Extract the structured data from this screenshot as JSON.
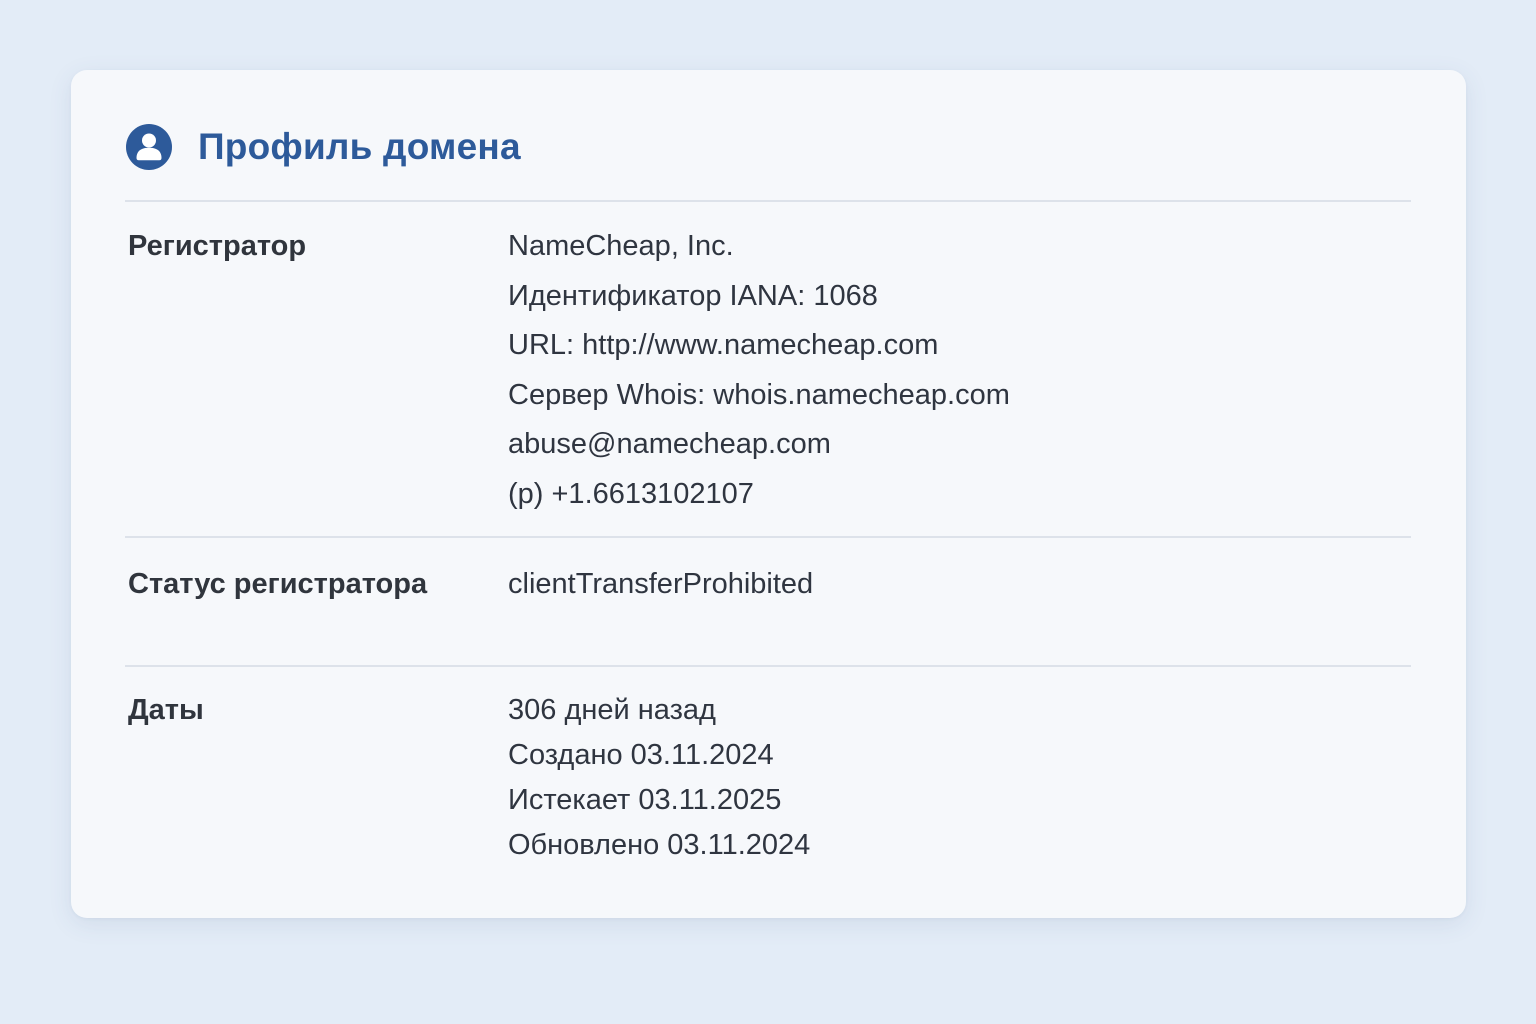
{
  "header": {
    "icon": "user-profile-icon",
    "title": "Профиль домена"
  },
  "colors": {
    "accent": "#2d5a9a",
    "background": "#e3ecf7",
    "card": "#f6f8fb",
    "divider": "#dde2ea"
  },
  "rows": {
    "registrar": {
      "label": "Регистратор",
      "values": [
        "NameCheap, Inc.",
        "Идентификатор IANA: 1068",
        "URL: http://www.namecheap.com",
        "Сервер Whois: whois.namecheap.com",
        "abuse@namecheap.com",
        "(p) +1.6613102107"
      ]
    },
    "registrar_status": {
      "label": "Статус регистратора",
      "values": [
        "clientTransferProhibited"
      ]
    },
    "dates": {
      "label": "Даты",
      "values": [
        "306 дней назад",
        "Создано 03.11.2024",
        "Истекает 03.11.2025",
        "Обновлено 03.11.2024"
      ]
    }
  }
}
